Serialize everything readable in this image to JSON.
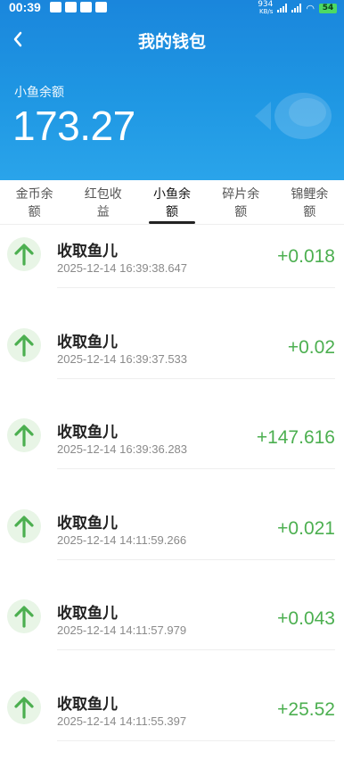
{
  "status_bar": {
    "time": "00:39",
    "net_speed": "934",
    "net_unit": "KB/s",
    "battery": "54"
  },
  "nav": {
    "back": "‹",
    "title": "我的钱包"
  },
  "balance": {
    "label": "小鱼余额",
    "value": "173.27"
  },
  "tabs": [
    {
      "label": "金币余额",
      "active": false
    },
    {
      "label": "红包收益",
      "active": false
    },
    {
      "label": "小鱼余额",
      "active": true
    },
    {
      "label": "碎片余额",
      "active": false
    },
    {
      "label": "锦鲤余额",
      "active": false
    }
  ],
  "records": [
    {
      "title": "收取鱼儿",
      "time": "2025-12-14 16:39:38.647",
      "amount": "+0.018"
    },
    {
      "title": "收取鱼儿",
      "time": "2025-12-14 16:39:37.533",
      "amount": "+0.02"
    },
    {
      "title": "收取鱼儿",
      "time": "2025-12-14 16:39:36.283",
      "amount": "+147.616"
    },
    {
      "title": "收取鱼儿",
      "time": "2025-12-14 14:11:59.266",
      "amount": "+0.021"
    },
    {
      "title": "收取鱼儿",
      "time": "2025-12-14 14:11:57.979",
      "amount": "+0.043"
    },
    {
      "title": "收取鱼儿",
      "time": "2025-12-14 14:11:55.397",
      "amount": "+25.52"
    }
  ],
  "colors": {
    "header": "#1a86dc",
    "amount": "#4caf50",
    "arrow": "#4caf50",
    "icon_bg": "#e8f5e6"
  },
  "icons": {
    "record": "arrow-up-icon",
    "header_deco": "fish-icon",
    "back": "chevron-left-icon"
  }
}
